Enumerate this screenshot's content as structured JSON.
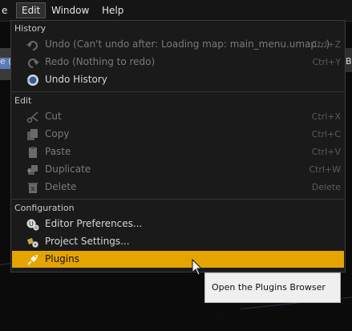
{
  "menubar": {
    "file": "e",
    "edit": "Edit",
    "window": "Window",
    "help": "Help"
  },
  "background": {
    "left_text": "e (",
    "right_text": "B"
  },
  "menu": {
    "sections": {
      "history": "History",
      "edit": "Edit",
      "configuration": "Configuration"
    },
    "items": {
      "undo": {
        "label": "Undo (Can't undo after: Loading map: main_menu.umap...)",
        "shortcut": "Ctrl+Z",
        "icon": "undo-icon"
      },
      "redo": {
        "label": "Redo (Nothing to redo)",
        "shortcut": "Ctrl+Y",
        "icon": "redo-icon"
      },
      "undo_history": {
        "label": "Undo History",
        "icon": "history-icon"
      },
      "cut": {
        "label": "Cut",
        "shortcut": "Ctrl+X",
        "icon": "scissors-icon"
      },
      "copy": {
        "label": "Copy",
        "shortcut": "Ctrl+C",
        "icon": "copy-icon"
      },
      "paste": {
        "label": "Paste",
        "shortcut": "Ctrl+V",
        "icon": "paste-icon"
      },
      "duplicate": {
        "label": "Duplicate",
        "shortcut": "Ctrl+W",
        "icon": "duplicate-icon"
      },
      "delete": {
        "label": "Delete",
        "shortcut": "Delete",
        "icon": "trash-icon"
      },
      "editor_preferences": {
        "label": "Editor Preferences...",
        "icon": "editor-preferences-icon"
      },
      "project_settings": {
        "label": "Project Settings...",
        "icon": "project-settings-icon"
      },
      "plugins": {
        "label": "Plugins",
        "icon": "plug-icon"
      }
    }
  },
  "tooltip": {
    "text": "Open the Plugins Browser tab."
  },
  "colors": {
    "highlight": "#e5a400",
    "menu_bg": "#1a1a1a",
    "tooltip_bg": "#efefef"
  }
}
